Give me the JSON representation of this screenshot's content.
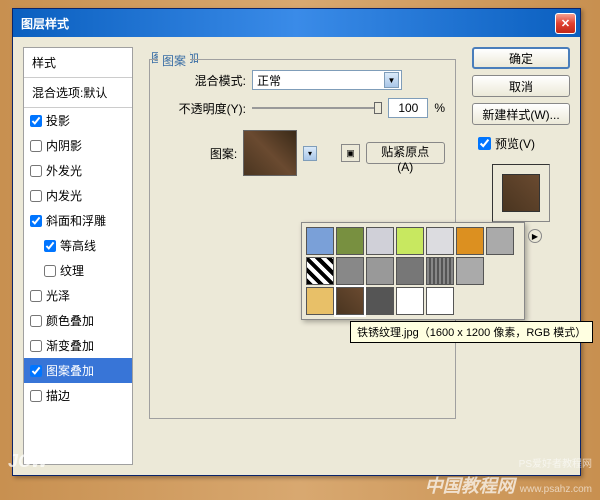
{
  "dialog": {
    "title": "图层样式"
  },
  "sidebar": {
    "styles_header": "样式",
    "blend_header": "混合选项:默认",
    "items": [
      {
        "label": "投影",
        "checked": true
      },
      {
        "label": "内阴影",
        "checked": false
      },
      {
        "label": "外发光",
        "checked": false
      },
      {
        "label": "内发光",
        "checked": false
      },
      {
        "label": "斜面和浮雕",
        "checked": true
      },
      {
        "label": "等高线",
        "checked": true,
        "indent": true
      },
      {
        "label": "纹理",
        "checked": false,
        "indent": true
      },
      {
        "label": "光泽",
        "checked": false
      },
      {
        "label": "颜色叠加",
        "checked": false
      },
      {
        "label": "渐变叠加",
        "checked": false
      },
      {
        "label": "图案叠加",
        "checked": true,
        "selected": true
      },
      {
        "label": "描边",
        "checked": false
      }
    ]
  },
  "main": {
    "group_title": "图案叠加",
    "fieldset_title": "图案",
    "blend_mode_label": "混合模式:",
    "blend_mode_value": "正常",
    "opacity_label": "不透明度(Y):",
    "opacity_value": "100",
    "opacity_unit": "%",
    "pattern_label": "图案:",
    "snap_origin_label": "贴紧原点(A)",
    "tooltip_text": "铁锈纹理.jpg（1600 x 1200 像素，RGB 模式）"
  },
  "buttons": {
    "ok": "确定",
    "cancel": "取消",
    "new_style": "新建样式(W)...",
    "preview": "预览(V)"
  },
  "watermark": {
    "left": "JCW",
    "right_main": "中国教程网",
    "right_sub1": "PS爱好者教程网",
    "right_sub2": "www.psahz.com"
  },
  "pattern_colors": [
    "#7aa0d8",
    "#789040",
    "#d0d0d8",
    "#c8e860",
    "#dcdce0",
    "#dc9020",
    "#aaa",
    "repeating-linear-gradient(45deg,#000 0 4px,#fff 4px 8px)",
    "#888",
    "#999",
    "#777",
    "repeating-linear-gradient(90deg,#888 0 2px,#555 2px 4px)",
    "#aaa",
    "",
    "#e8c068",
    "linear-gradient(45deg,#4a3520,#6a4a30)",
    "#555",
    "#fff",
    "#fff",
    "",
    ""
  ]
}
